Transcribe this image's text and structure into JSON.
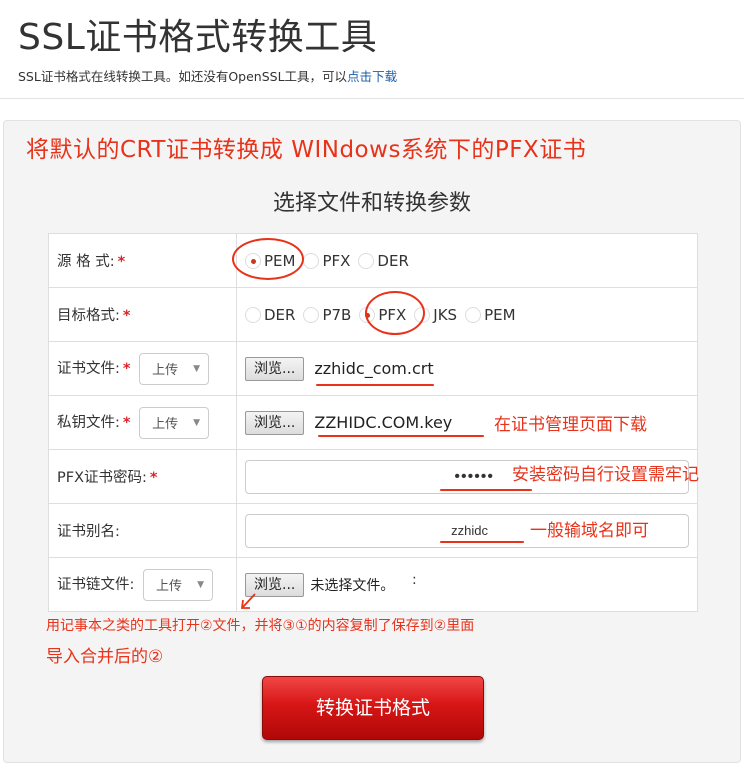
{
  "header": {
    "title": "SSL证书格式转换工具",
    "subtitle": "SSL证书格式在线转换工具。如还没有OpenSSL工具，可以",
    "download_link": "点击下载"
  },
  "annotations": {
    "headline": "将默认的CRT证书转换成 WINdows系统下的PFX证书",
    "key_note": "在证书管理页面下载",
    "password_note": "安装密码自行设置需牢记",
    "alias_note": "一般输域名即可",
    "chain_note_line1": "用记事本之类的工具打开②文件，并将③①的内容复制了保存到②里面",
    "chain_note_line2": "导入合并后的②",
    "stray_mark": ":"
  },
  "form": {
    "title": "选择文件和转换参数",
    "required_mark": "*",
    "source_format": {
      "label": "源 格 式:",
      "options": [
        "PEM",
        "PFX",
        "DER"
      ],
      "selected": "PEM"
    },
    "target_format": {
      "label": "目标格式:",
      "options": [
        "DER",
        "P7B",
        "PFX",
        "JKS",
        "PEM"
      ],
      "selected": "PFX"
    },
    "cert_file": {
      "label": "证书文件:",
      "upload_select": "上传",
      "browse_label": "浏览...",
      "filename": "zzhidc_com.crt"
    },
    "key_file": {
      "label": "私钥文件:",
      "upload_select": "上传",
      "browse_label": "浏览...",
      "filename": "ZZHIDC.COM.key"
    },
    "pfx_password": {
      "label": "PFX证书密码:",
      "value": "••••••"
    },
    "cert_alias": {
      "label": "证书别名:",
      "value": "zzhidc"
    },
    "chain_file": {
      "label": "证书链文件:",
      "upload_select": "上传",
      "browse_label": "浏览...",
      "filename": "未选择文件。"
    }
  },
  "convert_button": "转换证书格式",
  "colors": {
    "annotation": "#e8321a",
    "required": "#d9262c",
    "button": "#d71515",
    "link": "#1a5ea8"
  }
}
